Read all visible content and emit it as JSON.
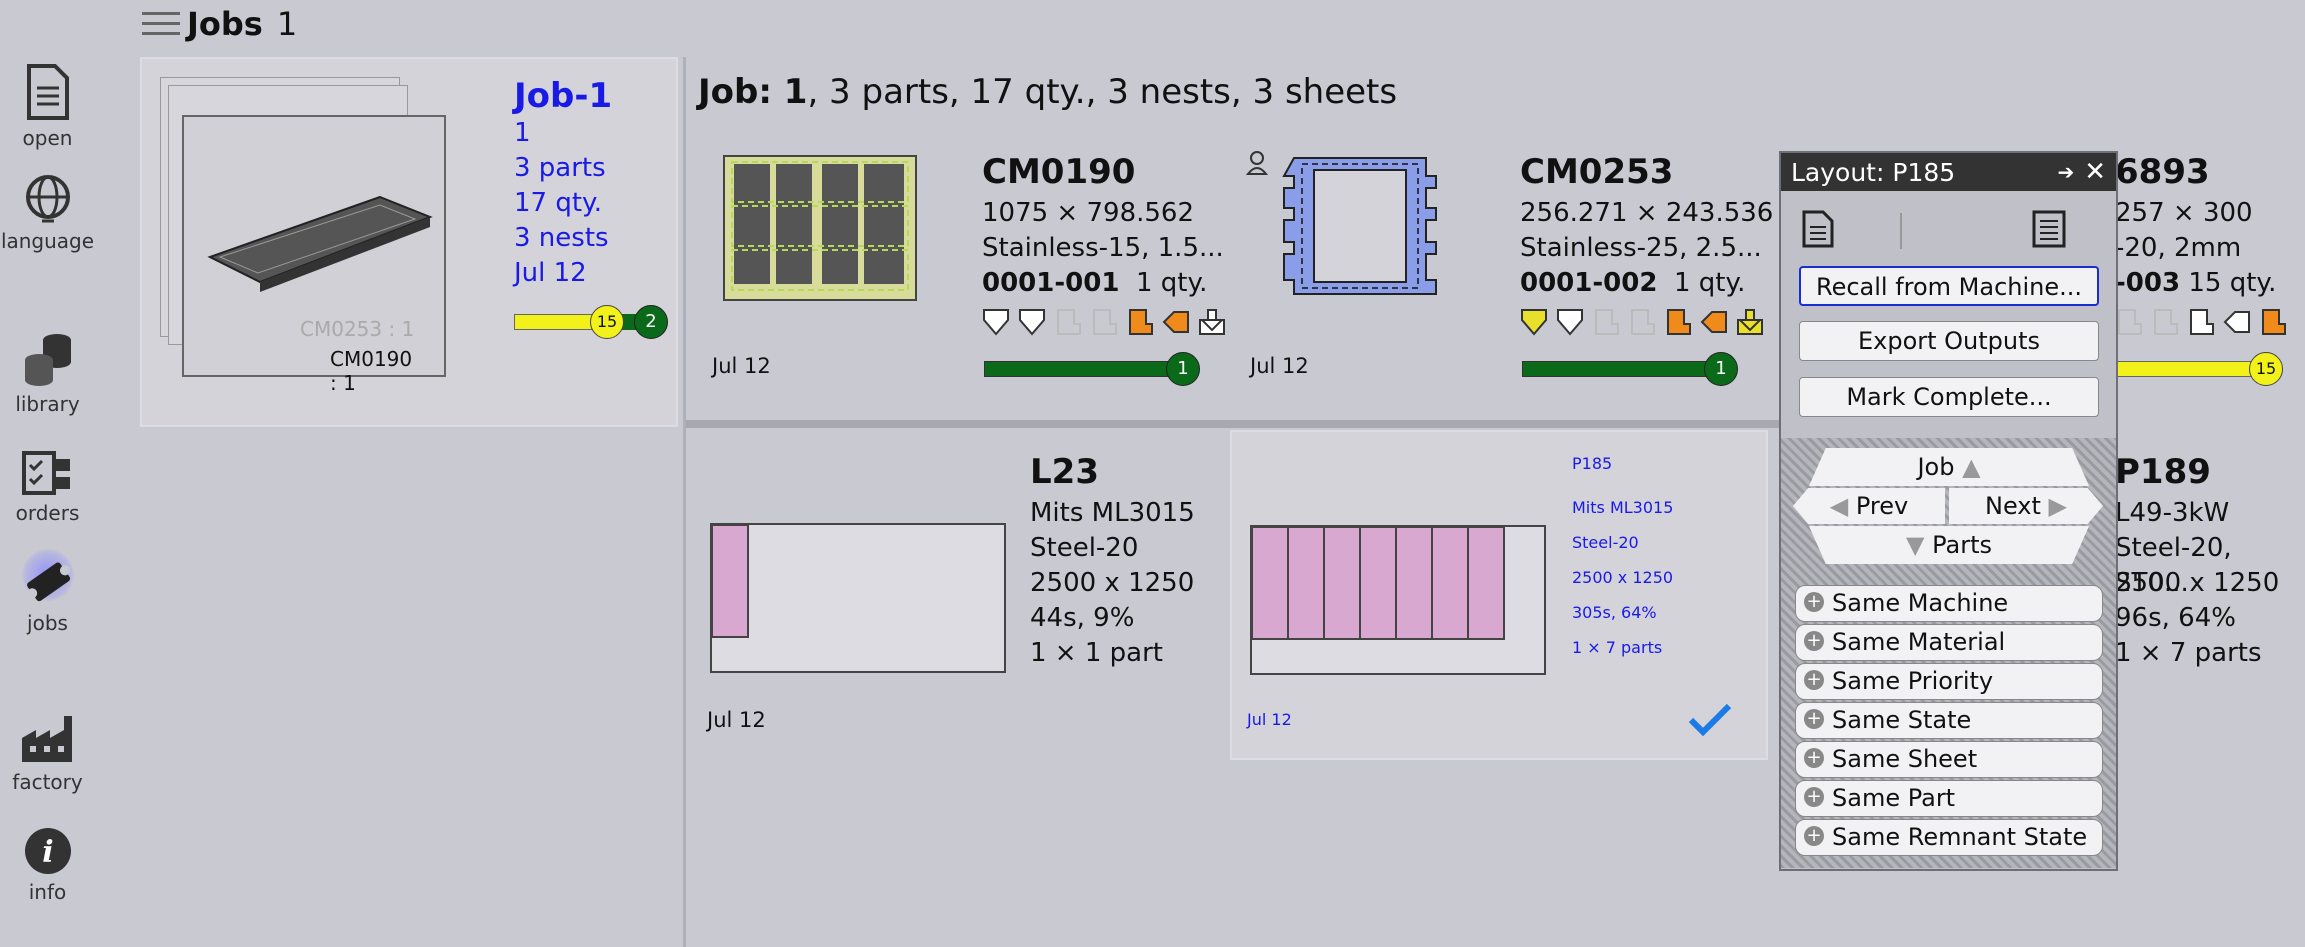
{
  "header": {
    "title": "Jobs",
    "count": "1"
  },
  "rail": [
    {
      "label": "open",
      "icon": "document-icon"
    },
    {
      "label": "language",
      "icon": "globe-icon"
    },
    {
      "label": "library",
      "icon": "database-icon"
    },
    {
      "label": "orders",
      "icon": "checklist-icon"
    },
    {
      "label": "jobs",
      "icon": "ticket-icon",
      "active": true
    },
    {
      "label": "factory",
      "icon": "factory-icon"
    },
    {
      "label": "info",
      "icon": "info-icon"
    }
  ],
  "job": {
    "title": "Job-1",
    "number": "1",
    "parts": "3 parts",
    "qty": "17 qty.",
    "nests": "3 nests",
    "date": "Jul 12",
    "thumb_label_back": "CM0253 : 1",
    "thumb_label_front": "CM0190 : 1",
    "progress_yellow": "15",
    "progress_green": "2"
  },
  "summary": {
    "bold": "Job: 1",
    "rest": ", 3 parts, 17 qty., 3 nests, 3 sheets"
  },
  "parts": [
    {
      "name": "CM0190",
      "dims": "1075 × 798.562",
      "material": "Stainless-15, 1.5...",
      "code": "0001-001",
      "qty": "1 qty.",
      "date": "Jul 12",
      "badge": "1"
    },
    {
      "name": "CM0253",
      "dims": "256.271 × 243.536",
      "material": "Stainless-25, 2.5...",
      "code": "0001-002",
      "qty": "1 qty.",
      "date": "Jul 12",
      "badge": "1"
    },
    {
      "name": "6893",
      "dims": "257 × 300",
      "material": "-20, 2mm",
      "code": "-003",
      "qty": "15 qty.",
      "badge": "15"
    }
  ],
  "nests": [
    {
      "name": "L23",
      "machine": "Mits ML3015",
      "material": "Steel-20",
      "sheet": "2500 x 1250",
      "time": "44s, 9%",
      "count": "1 × 1 part",
      "date": "Jul 12"
    },
    {
      "name": "P185",
      "machine": "Mits ML3015",
      "material": "Steel-20",
      "sheet": "2500 x 1250",
      "time": "305s, 64%",
      "count": "1 × 7 parts",
      "date": "Jul 12"
    },
    {
      "name": "P189",
      "machine": "L49-3kW",
      "material": "Steel-20, ST0...",
      "sheet": "2500 x 1250",
      "time": "96s, 64%",
      "count": "1 × 7 parts"
    }
  ],
  "popup": {
    "title_prefix": "Layout:",
    "title_name": "P185",
    "recall": "Recall from Machine...",
    "export": "Export Outputs",
    "complete": "Mark Complete...",
    "nav_job": "Job",
    "nav_prev": "Prev",
    "nav_next": "Next",
    "nav_parts": "Parts",
    "same": [
      "Same Machine",
      "Same Material",
      "Same Priority",
      "Same State",
      "Same Sheet",
      "Same Part",
      "Same Remnant State"
    ]
  },
  "colors": {
    "accent_blue": "#1a1ae6",
    "progress_green": "#0a6a1a",
    "progress_yellow": "#f2f21a",
    "nest_pink": "#d8a8d0",
    "part_blue": "#8a9de8"
  }
}
